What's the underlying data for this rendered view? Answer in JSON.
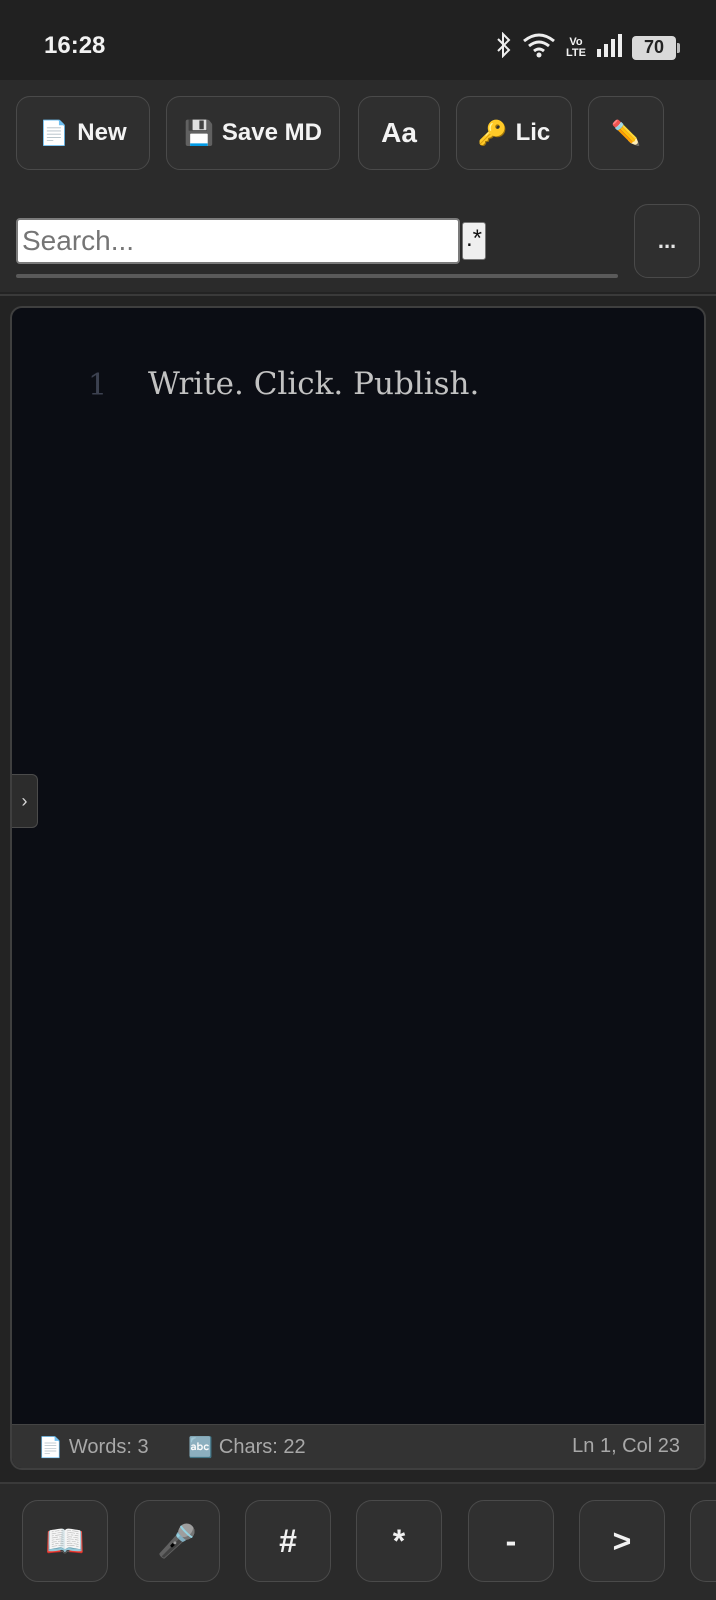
{
  "status_bar": {
    "time": "16:28",
    "volte_top": "Vo",
    "volte_bottom": "LTE",
    "battery": "70"
  },
  "toolbar": {
    "buttons": [
      {
        "icon": "📄",
        "label": "New"
      },
      {
        "icon": "💾",
        "label": "Save MD"
      },
      {
        "icon": "",
        "label": "Aa"
      },
      {
        "icon": "🔑",
        "label": "Lic"
      },
      {
        "icon": "✏️",
        "label": ""
      }
    ],
    "search_placeholder": "Search...",
    "regex_label": ".*",
    "more_label": "..."
  },
  "editor": {
    "line_number": "1",
    "line_text": "Write. Click. Publish.",
    "side_toggle": "›"
  },
  "editor_status": {
    "words_icon": "📄",
    "words": "Words: 3",
    "chars_icon": "🔤",
    "chars": "Chars: 22",
    "cursor": "Ln 1, Col 23"
  },
  "bottom_bar": {
    "keys": [
      "📖",
      "🎤",
      "#",
      "*",
      "-",
      ">",
      ""
    ]
  }
}
